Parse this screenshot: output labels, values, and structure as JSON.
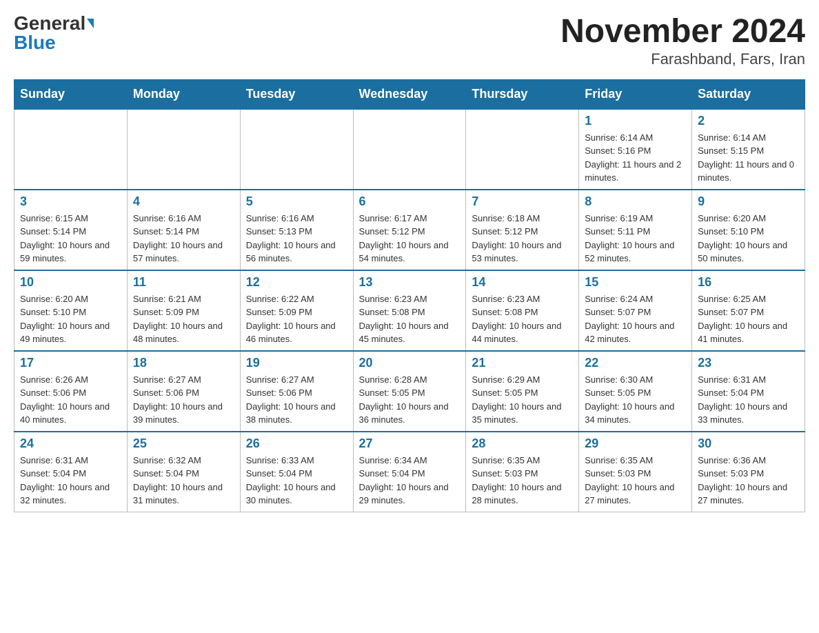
{
  "header": {
    "logo_general": "General",
    "logo_blue": "Blue",
    "month_title": "November 2024",
    "location": "Farashband, Fars, Iran"
  },
  "weekdays": [
    "Sunday",
    "Monday",
    "Tuesday",
    "Wednesday",
    "Thursday",
    "Friday",
    "Saturday"
  ],
  "weeks": [
    [
      {
        "day": "",
        "info": ""
      },
      {
        "day": "",
        "info": ""
      },
      {
        "day": "",
        "info": ""
      },
      {
        "day": "",
        "info": ""
      },
      {
        "day": "",
        "info": ""
      },
      {
        "day": "1",
        "info": "Sunrise: 6:14 AM\nSunset: 5:16 PM\nDaylight: 11 hours and 2 minutes."
      },
      {
        "day": "2",
        "info": "Sunrise: 6:14 AM\nSunset: 5:15 PM\nDaylight: 11 hours and 0 minutes."
      }
    ],
    [
      {
        "day": "3",
        "info": "Sunrise: 6:15 AM\nSunset: 5:14 PM\nDaylight: 10 hours and 59 minutes."
      },
      {
        "day": "4",
        "info": "Sunrise: 6:16 AM\nSunset: 5:14 PM\nDaylight: 10 hours and 57 minutes."
      },
      {
        "day": "5",
        "info": "Sunrise: 6:16 AM\nSunset: 5:13 PM\nDaylight: 10 hours and 56 minutes."
      },
      {
        "day": "6",
        "info": "Sunrise: 6:17 AM\nSunset: 5:12 PM\nDaylight: 10 hours and 54 minutes."
      },
      {
        "day": "7",
        "info": "Sunrise: 6:18 AM\nSunset: 5:12 PM\nDaylight: 10 hours and 53 minutes."
      },
      {
        "day": "8",
        "info": "Sunrise: 6:19 AM\nSunset: 5:11 PM\nDaylight: 10 hours and 52 minutes."
      },
      {
        "day": "9",
        "info": "Sunrise: 6:20 AM\nSunset: 5:10 PM\nDaylight: 10 hours and 50 minutes."
      }
    ],
    [
      {
        "day": "10",
        "info": "Sunrise: 6:20 AM\nSunset: 5:10 PM\nDaylight: 10 hours and 49 minutes."
      },
      {
        "day": "11",
        "info": "Sunrise: 6:21 AM\nSunset: 5:09 PM\nDaylight: 10 hours and 48 minutes."
      },
      {
        "day": "12",
        "info": "Sunrise: 6:22 AM\nSunset: 5:09 PM\nDaylight: 10 hours and 46 minutes."
      },
      {
        "day": "13",
        "info": "Sunrise: 6:23 AM\nSunset: 5:08 PM\nDaylight: 10 hours and 45 minutes."
      },
      {
        "day": "14",
        "info": "Sunrise: 6:23 AM\nSunset: 5:08 PM\nDaylight: 10 hours and 44 minutes."
      },
      {
        "day": "15",
        "info": "Sunrise: 6:24 AM\nSunset: 5:07 PM\nDaylight: 10 hours and 42 minutes."
      },
      {
        "day": "16",
        "info": "Sunrise: 6:25 AM\nSunset: 5:07 PM\nDaylight: 10 hours and 41 minutes."
      }
    ],
    [
      {
        "day": "17",
        "info": "Sunrise: 6:26 AM\nSunset: 5:06 PM\nDaylight: 10 hours and 40 minutes."
      },
      {
        "day": "18",
        "info": "Sunrise: 6:27 AM\nSunset: 5:06 PM\nDaylight: 10 hours and 39 minutes."
      },
      {
        "day": "19",
        "info": "Sunrise: 6:27 AM\nSunset: 5:06 PM\nDaylight: 10 hours and 38 minutes."
      },
      {
        "day": "20",
        "info": "Sunrise: 6:28 AM\nSunset: 5:05 PM\nDaylight: 10 hours and 36 minutes."
      },
      {
        "day": "21",
        "info": "Sunrise: 6:29 AM\nSunset: 5:05 PM\nDaylight: 10 hours and 35 minutes."
      },
      {
        "day": "22",
        "info": "Sunrise: 6:30 AM\nSunset: 5:05 PM\nDaylight: 10 hours and 34 minutes."
      },
      {
        "day": "23",
        "info": "Sunrise: 6:31 AM\nSunset: 5:04 PM\nDaylight: 10 hours and 33 minutes."
      }
    ],
    [
      {
        "day": "24",
        "info": "Sunrise: 6:31 AM\nSunset: 5:04 PM\nDaylight: 10 hours and 32 minutes."
      },
      {
        "day": "25",
        "info": "Sunrise: 6:32 AM\nSunset: 5:04 PM\nDaylight: 10 hours and 31 minutes."
      },
      {
        "day": "26",
        "info": "Sunrise: 6:33 AM\nSunset: 5:04 PM\nDaylight: 10 hours and 30 minutes."
      },
      {
        "day": "27",
        "info": "Sunrise: 6:34 AM\nSunset: 5:04 PM\nDaylight: 10 hours and 29 minutes."
      },
      {
        "day": "28",
        "info": "Sunrise: 6:35 AM\nSunset: 5:03 PM\nDaylight: 10 hours and 28 minutes."
      },
      {
        "day": "29",
        "info": "Sunrise: 6:35 AM\nSunset: 5:03 PM\nDaylight: 10 hours and 27 minutes."
      },
      {
        "day": "30",
        "info": "Sunrise: 6:36 AM\nSunset: 5:03 PM\nDaylight: 10 hours and 27 minutes."
      }
    ]
  ]
}
